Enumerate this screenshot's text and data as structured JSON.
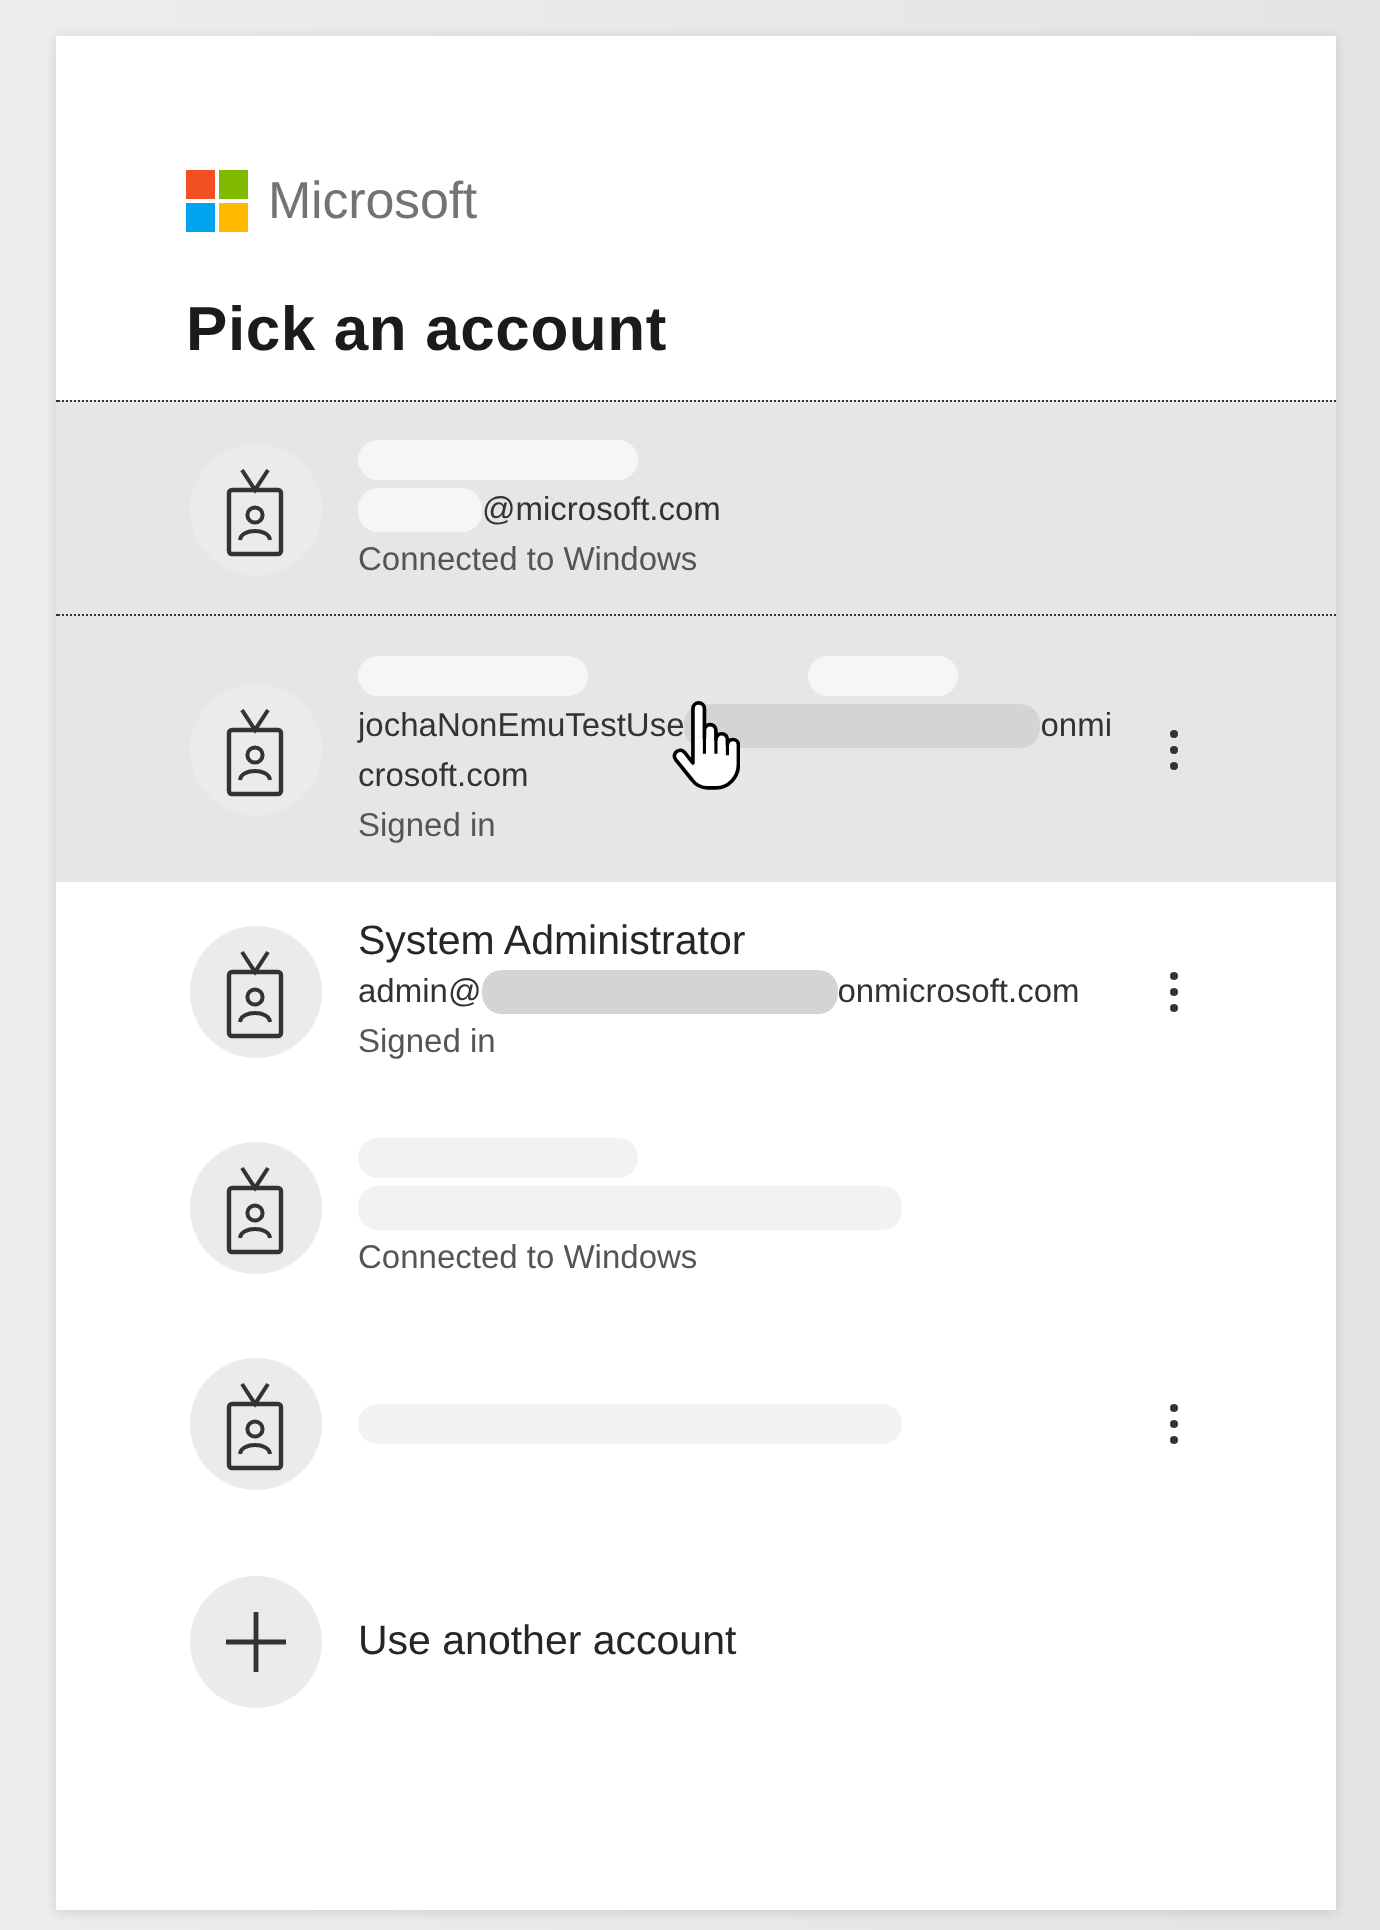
{
  "brand": {
    "name": "Microsoft"
  },
  "title": "Pick an account",
  "accounts": [
    {
      "focused": true,
      "hovered": false,
      "menu": false,
      "lines": [
        {
          "kind": "name",
          "segments": [
            {
              "kind": "redacted",
              "color": "#f6f6f6"
            }
          ]
        },
        {
          "kind": "email",
          "segments": [
            {
              "kind": "redacted",
              "color": "#f6f6f6"
            },
            {
              "kind": "text",
              "text": "@microsoft.com"
            }
          ]
        },
        {
          "kind": "status",
          "segments": [
            {
              "kind": "text",
              "text": "Connected to Windows"
            }
          ]
        }
      ]
    },
    {
      "focused": false,
      "hovered": true,
      "menu": true,
      "lines": [
        {
          "kind": "name",
          "segments": [
            {
              "kind": "redacted",
              "color": "#f6f6f6"
            },
            {
              "kind": "redacted",
              "color": "#f6f6f6"
            }
          ]
        },
        {
          "kind": "email",
          "segments": [
            {
              "kind": "text",
              "text": "jochaNonEmuTestUse"
            },
            {
              "kind": "redacted",
              "color": "#d3d4d6"
            },
            {
              "kind": "text",
              "text": "onmi"
            }
          ]
        },
        {
          "kind": "email",
          "segments": [
            {
              "kind": "text",
              "text": "crosoft.com"
            }
          ]
        },
        {
          "kind": "status",
          "segments": [
            {
              "kind": "text",
              "text": "Signed in"
            }
          ]
        }
      ]
    },
    {
      "focused": false,
      "hovered": false,
      "menu": true,
      "lines": [
        {
          "kind": "name",
          "segments": [
            {
              "kind": "text",
              "text": "System Administrator"
            }
          ]
        },
        {
          "kind": "email",
          "segments": [
            {
              "kind": "text",
              "text": "admin@"
            },
            {
              "kind": "redacted",
              "color": "#d3d4d6"
            },
            {
              "kind": "text",
              "text": "onmicrosoft.com"
            }
          ]
        },
        {
          "kind": "status",
          "segments": [
            {
              "kind": "text",
              "text": "Signed in"
            }
          ]
        }
      ]
    },
    {
      "focused": false,
      "hovered": false,
      "menu": false,
      "lines": [
        {
          "kind": "name",
          "segments": [
            {
              "kind": "redacted",
              "color": "#f2f2f2"
            }
          ]
        },
        {
          "kind": "email",
          "segments": [
            {
              "kind": "redacted",
              "color": "#f2f2f2"
            }
          ]
        },
        {
          "kind": "status",
          "segments": [
            {
              "kind": "text",
              "text": "Connected to Windows"
            }
          ]
        }
      ]
    },
    {
      "focused": false,
      "hovered": false,
      "menu": true,
      "lines": [
        {
          "kind": "name",
          "segments": [
            {
              "kind": "redacted",
              "color": "#f2f2f2"
            }
          ]
        }
      ]
    }
  ],
  "add_account": {
    "label": "Use another account"
  }
}
